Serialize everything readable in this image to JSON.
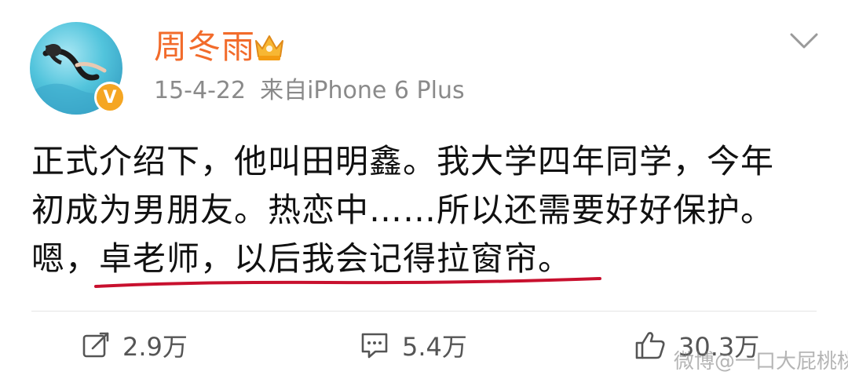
{
  "post": {
    "username": "周冬雨",
    "date": "15-4-22",
    "source": "来自iPhone 6 Plus",
    "verified_mark": "V",
    "text_lines": [
      "正式介绍下，他叫田明鑫。我大学四年同学，今年",
      "初成为男朋友。热恋中……所以还需要好好保护。",
      "嗯，卓老师，以后我会记得拉窗帘。"
    ]
  },
  "actions": {
    "repost_count": "2.9万",
    "comment_count": "5.4万",
    "like_count": "30.3万"
  },
  "watermark": "微博@一口大屁桃桃",
  "icons": {
    "crown": "crown-icon",
    "chevron": "chevron-down-icon",
    "repost": "repost-icon",
    "comment": "comment-icon",
    "like": "thumbs-up-icon"
  },
  "colors": {
    "username": "#f26b2b",
    "verified_badge": "#f5a623",
    "meta_text": "#8a8a8a",
    "annotation_underline": "#c8102e"
  }
}
